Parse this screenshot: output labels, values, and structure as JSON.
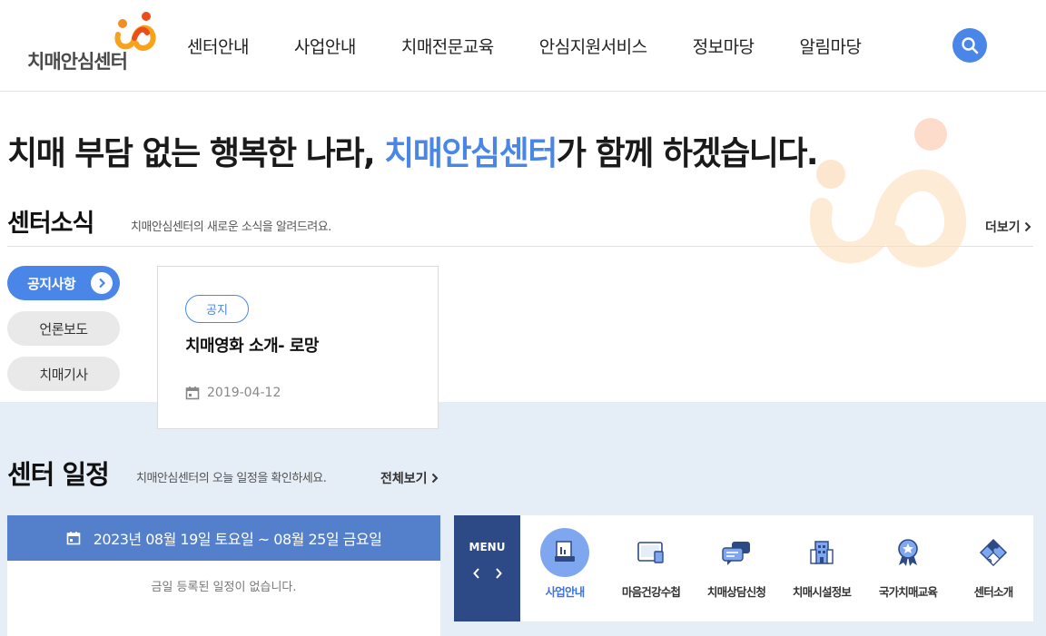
{
  "header": {
    "logo_text": "치매안심센터",
    "nav": [
      "센터안내",
      "사업안내",
      "치매전문교육",
      "안심지원서비스",
      "정보마당",
      "알림마당"
    ]
  },
  "hero": {
    "title_pre": "치매 부담 없는 행복한 나라, ",
    "title_highlight": "치매안심센터",
    "title_post": "가 함께 하겠습니다."
  },
  "news": {
    "title": "센터소식",
    "desc": "치매안심센터의 새로운 소식을 알려드려요.",
    "more": "더보기",
    "tabs": [
      "공지사항",
      "언론보도",
      "치매기사"
    ],
    "card": {
      "badge": "공지",
      "title": "치매영화 소개- 로망",
      "date": "2019-04-12"
    }
  },
  "schedule": {
    "title": "센터 일정",
    "desc": "치매안심센터의 오늘 일정을 확인하세요.",
    "more": "전체보기",
    "range": "2023년 08월 19일 토요일 ~ 08월 25일 금요일",
    "empty": "금일 등록된 일정이 없습니다."
  },
  "menu": {
    "label": "MENU",
    "items": [
      {
        "label": "사업안내",
        "icon": "document-icon",
        "active": true
      },
      {
        "label": "마음건강수첩",
        "icon": "notebook-icon"
      },
      {
        "label": "치매상담신청",
        "icon": "chat-icon"
      },
      {
        "label": "치매시설정보",
        "icon": "building-icon"
      },
      {
        "label": "국가치매교육",
        "icon": "award-icon"
      },
      {
        "label": "센터소개",
        "icon": "puzzle-icon"
      }
    ]
  },
  "colors": {
    "accent": "#4a86e8",
    "navy": "#2e4a86",
    "bar": "#5480cb",
    "section_bg": "#e5edf6"
  }
}
